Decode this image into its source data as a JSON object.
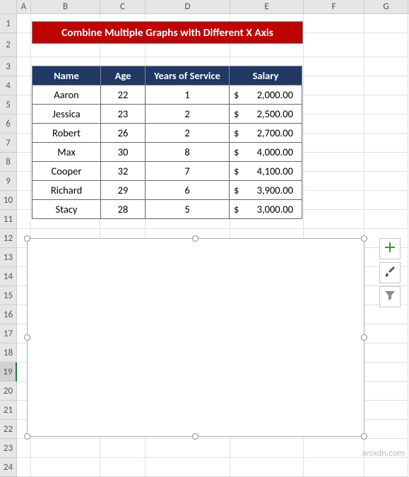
{
  "columns": [
    "A",
    "B",
    "C",
    "D",
    "E",
    "F",
    "G"
  ],
  "rows": [
    1,
    2,
    3,
    4,
    5,
    6,
    7,
    8,
    9,
    10,
    11,
    12,
    13,
    14,
    15,
    16,
    17,
    18,
    19,
    20,
    21,
    22,
    23,
    24
  ],
  "selected_row": 19,
  "title": "Combine Multiple Graphs with Different X Axis",
  "table": {
    "headers": {
      "name": "Name",
      "age": "Age",
      "yos": "Years of Service",
      "salary": "Salary"
    },
    "rows": [
      {
        "name": "Aaron",
        "age": "22",
        "yos": "1",
        "currency": "$",
        "salary": "2,000.00"
      },
      {
        "name": "Jessica",
        "age": "23",
        "yos": "2",
        "currency": "$",
        "salary": "2,500.00"
      },
      {
        "name": "Robert",
        "age": "26",
        "yos": "2",
        "currency": "$",
        "salary": "2,700.00"
      },
      {
        "name": "Max",
        "age": "30",
        "yos": "8",
        "currency": "$",
        "salary": "4,000.00"
      },
      {
        "name": "Cooper",
        "age": "32",
        "yos": "7",
        "currency": "$",
        "salary": "4,100.00"
      },
      {
        "name": "Richard",
        "age": "29",
        "yos": "6",
        "currency": "$",
        "salary": "3,900.00"
      },
      {
        "name": "Stacy",
        "age": "28",
        "yos": "5",
        "currency": "$",
        "salary": "3,000.00"
      }
    ]
  },
  "side_tools": {
    "add": "plus-icon",
    "style": "brush-icon",
    "filter": "funnel-icon"
  },
  "watermark": "wsxdn.com"
}
